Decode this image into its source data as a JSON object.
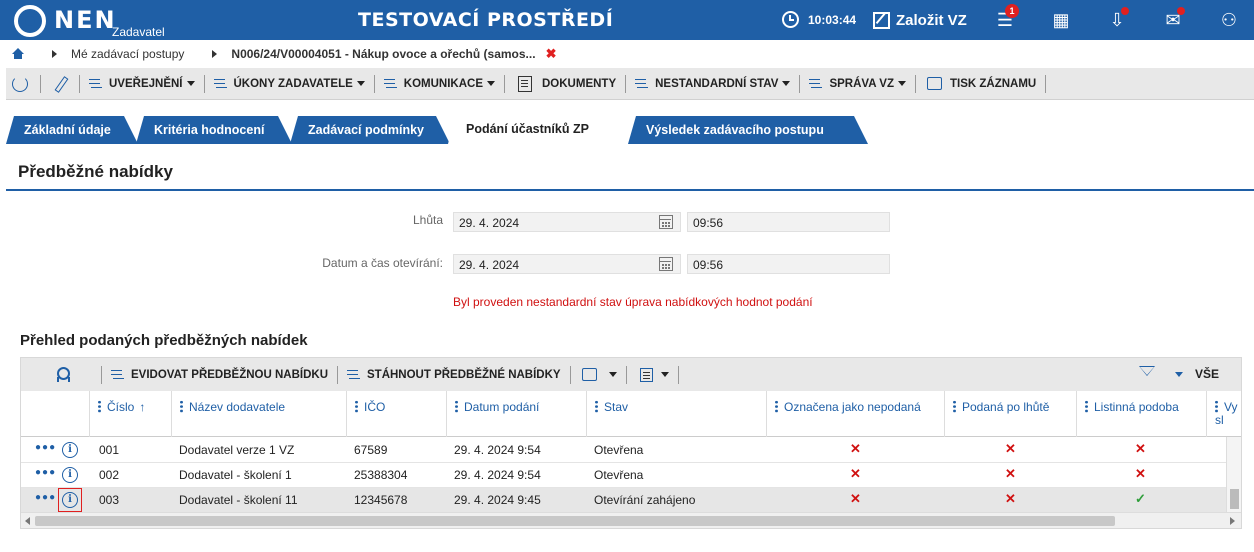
{
  "header": {
    "logo_text": "NEN",
    "logo_sub": "Zadavatel",
    "env_title": "TESTOVACÍ PROSTŘEDÍ",
    "time": "10:03:44",
    "create_label": "Založit VZ",
    "notifications_badge": "1",
    "accent_color": "#1f5fa6"
  },
  "breadcrumb": {
    "items": [
      "Mé zadávací postupy",
      "N006/24/V00004051 - Nákup ovoce a ořechů (samos..."
    ]
  },
  "toolbar": {
    "items": [
      {
        "label": "UVEŘEJNĚNÍ",
        "dropdown": true
      },
      {
        "label": "ÚKONY ZADAVATELE",
        "dropdown": true
      },
      {
        "label": "KOMUNIKACE",
        "dropdown": true
      },
      {
        "label": "DOKUMENTY",
        "dropdown": false
      },
      {
        "label": "NESTANDARDNÍ STAV",
        "dropdown": true
      },
      {
        "label": "SPRÁVA VZ",
        "dropdown": true
      },
      {
        "label": "TISK ZÁZNAMU",
        "dropdown": false
      }
    ]
  },
  "tabs": [
    {
      "label": "Základní údaje",
      "active": false
    },
    {
      "label": "Kritéria hodnocení",
      "active": false
    },
    {
      "label": "Zadávací podmínky",
      "active": false
    },
    {
      "label": "Podání účastníků ZP",
      "active": true
    },
    {
      "label": "Výsledek zadávacího postupu",
      "active": false
    }
  ],
  "section": {
    "title": "Předběžné nabídky",
    "deadline_label": "Lhůta",
    "deadline_date": "29. 4. 2024",
    "deadline_time": "09:56",
    "opening_label": "Datum a čas otevírání:",
    "opening_date": "29. 4. 2024",
    "opening_time": "09:56",
    "warning": "Byl proveden nestandardní stav úprava nabídkových hodnot podání"
  },
  "grid": {
    "title": "Přehled podaných předběžných nabídek",
    "toolbar": {
      "register_label": "EVIDOVAT PŘEDBĚŽNOU NABÍDKU",
      "download_label": "STÁHNOUT PŘEDBĚŽNÉ NABÍDKY",
      "all_label": "VŠE"
    },
    "columns": [
      "Číslo",
      "Název dodavatele",
      "IČO",
      "Datum podání",
      "Stav",
      "Označena jako nepodaná",
      "Podaná po lhůtě",
      "Listinná podoba",
      "Vy sl"
    ],
    "rows": [
      {
        "num": "001",
        "supplier": "Dodavatel verze 1 VZ",
        "ico": "67589",
        "date": "29. 4. 2024 9:54",
        "state": "Otevřena",
        "not_submitted": "✕",
        "late": "✕",
        "paper": "✕"
      },
      {
        "num": "002",
        "supplier": "Dodavatel - školení 1",
        "ico": "25388304",
        "date": "29. 4. 2024 9:54",
        "state": "Otevřena",
        "not_submitted": "✕",
        "late": "✕",
        "paper": "✕"
      },
      {
        "num": "003",
        "supplier": "Dodavatel - školení 11",
        "ico": "12345678",
        "date": "29. 4. 2024 9:45",
        "state": "Otevírání zahájeno",
        "not_submitted": "✕",
        "late": "✕",
        "paper": "✓"
      }
    ]
  }
}
